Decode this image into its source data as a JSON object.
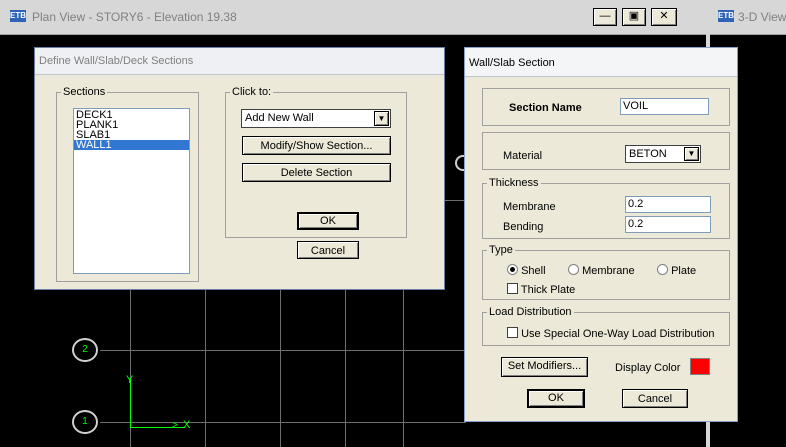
{
  "plan_window": {
    "title": "Plan View - STORY6 - Elevation 19.38"
  },
  "view3d_window": {
    "title": "3-D View"
  },
  "grid_labels": [
    "2",
    "1"
  ],
  "axes": {
    "x": "X",
    "y": "Y"
  },
  "define_dialog": {
    "title": "Define Wall/Slab/Deck Sections",
    "sections_label": "Sections",
    "sections": [
      "DECK1",
      "PLANK1",
      "SLAB1",
      "WALL1"
    ],
    "selected_section": "WALL1",
    "click_to_label": "Click to:",
    "add_dropdown_value": "Add New Wall",
    "modify_button": "Modify/Show Section...",
    "delete_button": "Delete Section",
    "ok_button": "OK",
    "cancel_button": "Cancel"
  },
  "wall_dialog": {
    "title": "Wall/Slab Section",
    "section_name_label": "Section Name",
    "section_name_value": "VOIL",
    "material_label": "Material",
    "material_value": "BETON",
    "thickness_label": "Thickness",
    "membrane_label": "Membrane",
    "membrane_value": "0.2",
    "bending_label": "Bending",
    "bending_value": "0.2",
    "type_label": "Type",
    "type_shell": "Shell",
    "type_membrane": "Membrane",
    "type_plate": "Plate",
    "thick_plate": "Thick Plate",
    "load_dist_label": "Load Distribution",
    "load_dist_option": "Use Special One-Way Load Distribution",
    "set_modifiers_button": "Set Modifiers...",
    "display_color_label": "Display Color",
    "display_color": "#ff0000",
    "ok_button": "OK",
    "cancel_button": "Cancel"
  },
  "colors": {
    "canvas": "#000000",
    "grid": "#6e6e6e",
    "axis": "#00ff00"
  }
}
